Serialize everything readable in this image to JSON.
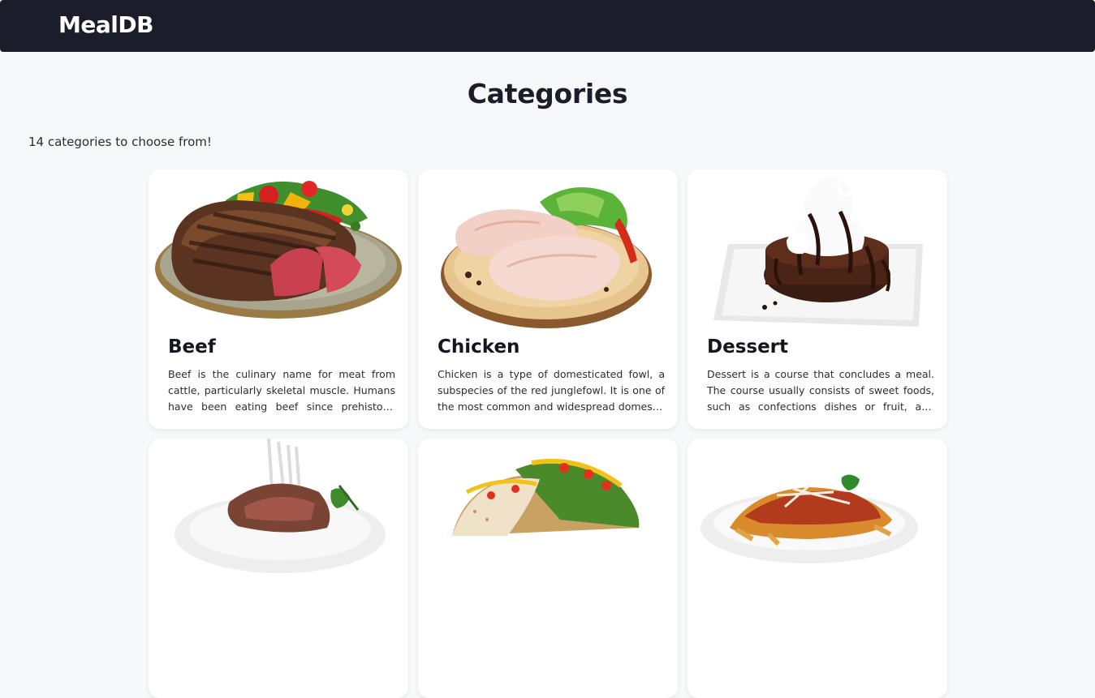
{
  "nav": {
    "brand": "MealDB"
  },
  "page": {
    "title": "Categories",
    "count_text": "14 categories to choose from!"
  },
  "categories": [
    {
      "name": "Beef",
      "description": "Beef is the culinary name for meat from cattle, particularly skeletal muscle. Humans have been eating beef since prehistoric times.",
      "image_icon": "beef-steak-image"
    },
    {
      "name": "Chicken",
      "description": "Chicken is a type of domesticated fowl, a subspecies of the red junglefowl. It is one of the most common and widespread domestic animals.",
      "image_icon": "chicken-legs-image"
    },
    {
      "name": "Dessert",
      "description": "Dessert is a course that concludes a meal. The course usually consists of sweet foods, such as confections dishes or fruit, and possibly a beverage.",
      "image_icon": "chocolate-cake-image"
    },
    {
      "name": "",
      "description": "",
      "image_icon": "lamb-chops-image"
    },
    {
      "name": "",
      "description": "",
      "image_icon": "tacos-image"
    },
    {
      "name": "",
      "description": "",
      "image_icon": "pasta-image"
    }
  ],
  "colors": {
    "navbar": "#1c1d2b",
    "background": "#f7f8fa",
    "card": "#ffffff",
    "text": "#1b1d2a"
  }
}
